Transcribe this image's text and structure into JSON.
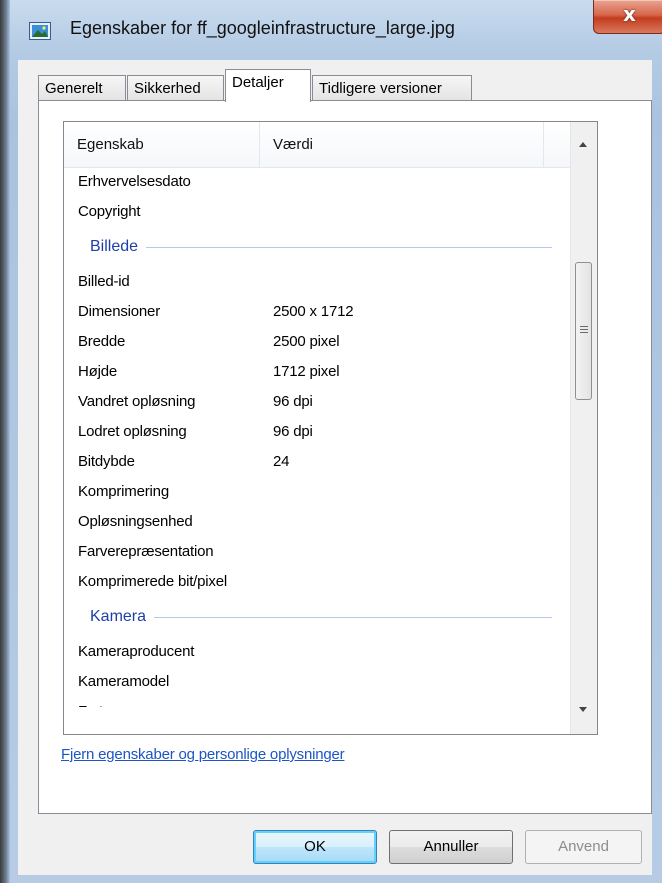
{
  "window": {
    "title": "Egenskaber for ff_googleinfrastructure_large.jpg",
    "close_label": "x"
  },
  "tabs": [
    {
      "label": "Generelt",
      "active": false
    },
    {
      "label": "Sikkerhed",
      "active": false
    },
    {
      "label": "Detaljer",
      "active": true
    },
    {
      "label": "Tidligere versioner",
      "active": false
    }
  ],
  "list": {
    "columns": [
      "Egenskab",
      "Værdi"
    ],
    "rows_top": [
      {
        "name": "Erhvervelsesdato",
        "value": ""
      },
      {
        "name": "Copyright",
        "value": ""
      }
    ],
    "groups": [
      {
        "label": "Billede",
        "rows": [
          {
            "name": "Billed-id",
            "value": ""
          },
          {
            "name": "Dimensioner",
            "value": "2500 x 1712"
          },
          {
            "name": "Bredde",
            "value": "2500 pixel"
          },
          {
            "name": "Højde",
            "value": "1712 pixel"
          },
          {
            "name": "Vandret opløsning",
            "value": "96 dpi"
          },
          {
            "name": "Lodret opløsning",
            "value": "96 dpi"
          },
          {
            "name": "Bitdybde",
            "value": "24"
          },
          {
            "name": "Komprimering",
            "value": ""
          },
          {
            "name": "Opløsningsenhed",
            "value": ""
          },
          {
            "name": "Farverepræsentation",
            "value": ""
          },
          {
            "name": "Komprimerede bit/pixel",
            "value": ""
          }
        ]
      },
      {
        "label": "Kamera",
        "rows": [
          {
            "name": "Kameraproducent",
            "value": ""
          },
          {
            "name": "Kameramodel",
            "value": ""
          },
          {
            "name": "F-stop",
            "value": ""
          }
        ]
      }
    ]
  },
  "remove_link": "Fjern egenskaber og personlige oplysninger",
  "buttons": {
    "ok": "OK",
    "cancel": "Annuller",
    "apply": "Anvend"
  },
  "colors": {
    "group_label": "#1e3fa8",
    "link": "#1d55c4",
    "close_button": "#c23d20"
  }
}
